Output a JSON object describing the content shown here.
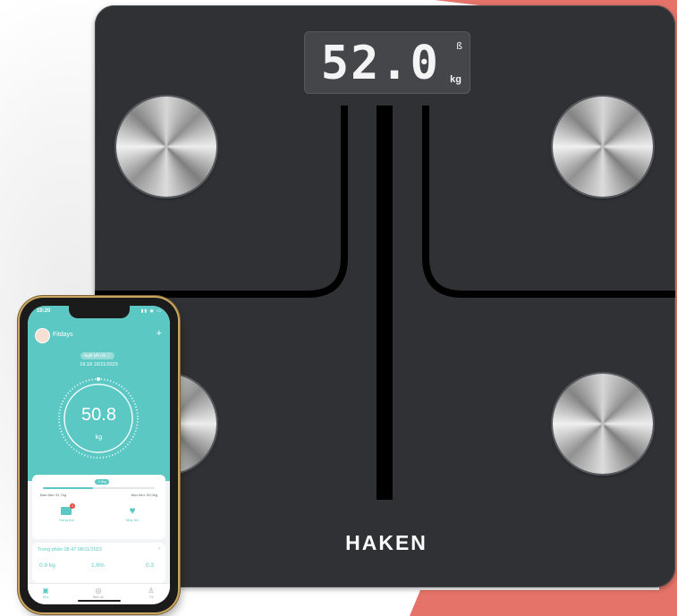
{
  "colors": {
    "accent": "#e57369",
    "scale_body": "#2f3134",
    "app_teal": "#5cc8c4"
  },
  "scale": {
    "display_value": "52.0",
    "display_unit": "kg",
    "bluetooth_icon": "bluetooth-icon",
    "brand": "HAKEN"
  },
  "phone": {
    "status_time": "10:20",
    "app": {
      "title": "Fitdays",
      "add_icon": "plus-icon",
      "connection_status": "Ngắt kết nối ⓘ",
      "measure_time": "16:18 16/11/2023",
      "weight_value": "50.8",
      "weight_unit": "kg",
      "goal": {
        "chip": "-0.8kg",
        "start": "Ban đầu: 51.7kg",
        "target": "Mục tiêu: 50.0kg"
      },
      "quick_actions": [
        {
          "label": "Trang trại",
          "icon": "mail-icon",
          "badge": "1"
        },
        {
          "label": "Máy tim",
          "icon": "heart-icon"
        }
      ],
      "composition": {
        "title": "Trọng phần 08:47 08/11/2023",
        "values": [
          "0.9 kg",
          "1.6%",
          "0.3"
        ]
      },
      "tabs": [
        {
          "label": "Nhà",
          "icon": "scale-icon"
        },
        {
          "label": "Biểu đồ",
          "icon": "chart-icon"
        },
        {
          "label": "Tôi",
          "icon": "user-icon"
        }
      ]
    }
  }
}
